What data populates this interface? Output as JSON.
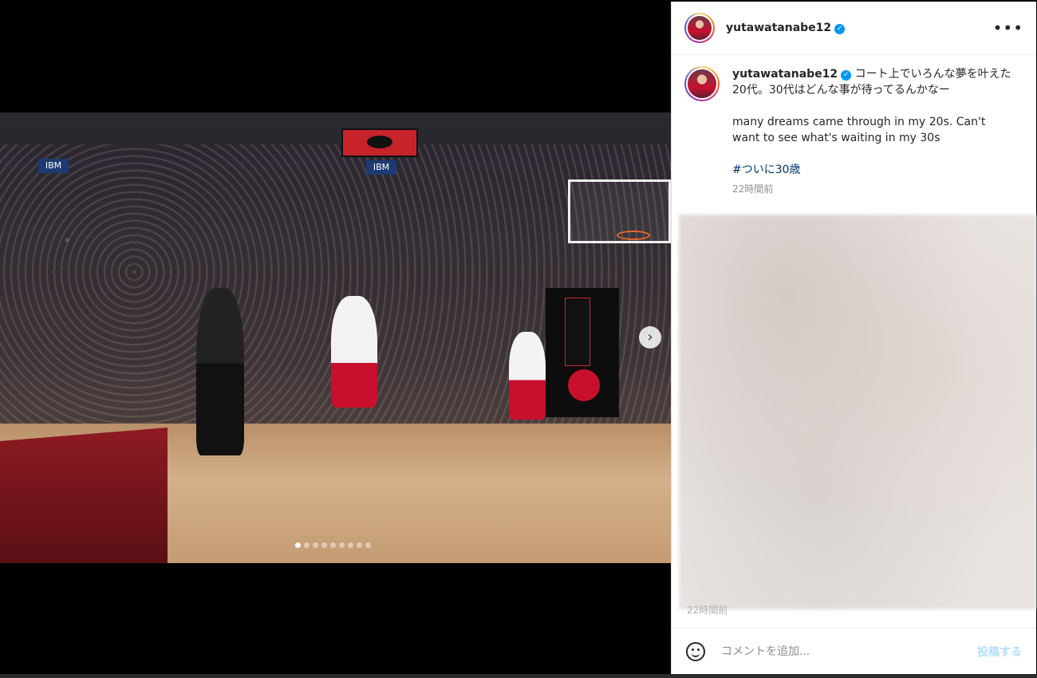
{
  "post": {
    "username": "yutawatanabe12",
    "caption_ja": "コート上でいろんな夢を叶えた20代。30代はどんな事が待ってるんかなー",
    "caption_en": "many dreams came through in my 20s. Can't want to see what's waiting in my 30s",
    "hashtag": "#ついに30歳",
    "time": "22時間前",
    "faded_time": "22時間前"
  },
  "photo": {
    "slide_count": 9,
    "active_slide": 1,
    "ibm_text": "IBM"
  },
  "comment": {
    "placeholder": "コメントを追加...",
    "post_label": "投稿する"
  },
  "icons": {
    "verified": "verified-badge-icon",
    "more": "more-options-icon",
    "next": "chevron-right-icon",
    "emoji": "emoji-icon"
  },
  "colors": {
    "verified": "#0095f6",
    "hashtag": "#00376b",
    "post_disabled": "#b2dffc"
  }
}
